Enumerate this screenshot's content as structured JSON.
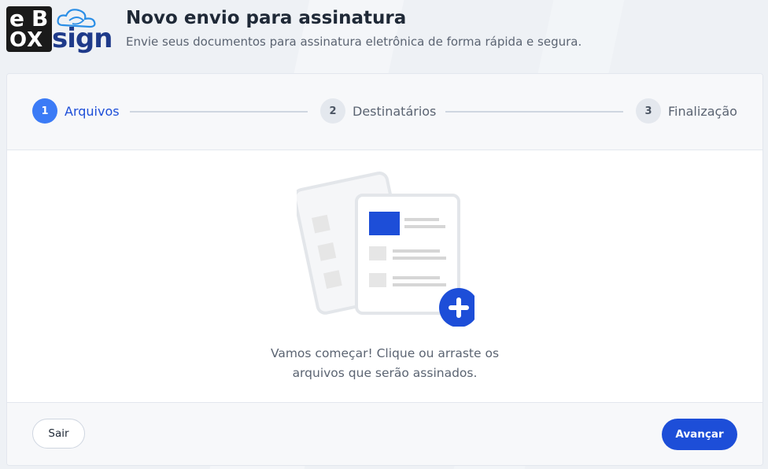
{
  "brand": {
    "logo_text_top": "eB",
    "logo_text_bottom": "OX",
    "logo_text_sign": "sign"
  },
  "header": {
    "title": "Novo envio para assinatura",
    "subtitle": "Envie seus documentos para assinatura eletrônica de forma rápida e segura."
  },
  "stepper": {
    "steps": [
      {
        "number": "1",
        "label": "Arquivos",
        "active": true
      },
      {
        "number": "2",
        "label": "Destinatários",
        "active": false
      },
      {
        "number": "3",
        "label": "Finalização",
        "active": false
      }
    ]
  },
  "dropzone": {
    "line1": "Vamos começar! Clique ou arraste os",
    "line2": "arquivos que serão assinados.",
    "icon": "documents-add-icon"
  },
  "footer": {
    "exit_label": "Sair",
    "next_label": "Avançar"
  },
  "colors": {
    "accent": "#1d4ed8",
    "active_step": "#3b7bf6",
    "page_bg": "#eef1f5"
  }
}
